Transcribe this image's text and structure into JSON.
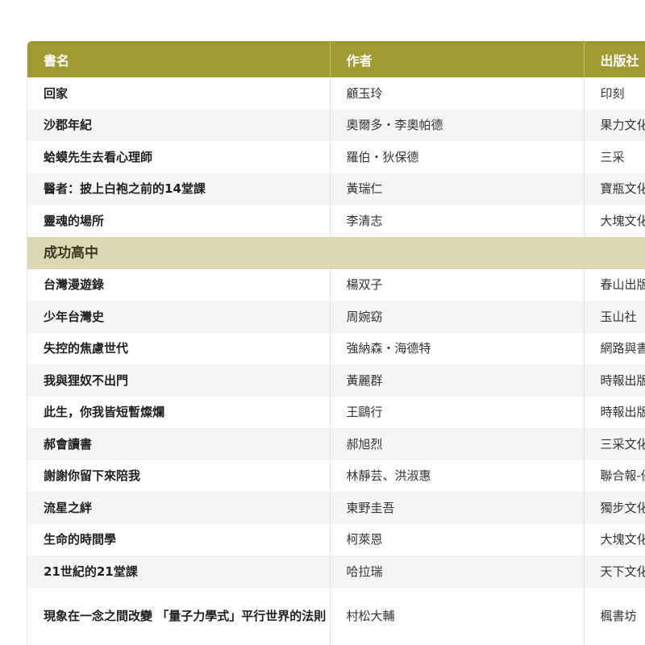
{
  "table": {
    "headers": [
      "書名",
      "作者",
      "出版社"
    ],
    "group_a": [
      {
        "title": "回家",
        "author": "顧玉玲",
        "publisher": "印刻"
      },
      {
        "title": "沙郡年紀",
        "author": "奧爾多・李奧帕德",
        "publisher": "果力文化"
      },
      {
        "title": "蛤蟆先生去看心理師",
        "author": "羅伯・狄保德",
        "publisher": "三采"
      },
      {
        "title": "醫者：披上白袍之前的14堂課",
        "author": "黃瑞仁",
        "publisher": "寶瓶文化"
      },
      {
        "title": "靈魂的場所",
        "author": "李清志",
        "publisher": "大塊文化"
      }
    ],
    "section_label": "成功高中",
    "group_b": [
      {
        "title": "台灣漫遊錄",
        "author": "楊双子",
        "publisher": "春山出版"
      },
      {
        "title": "少年台灣史",
        "author": "周婉窈",
        "publisher": "玉山社"
      },
      {
        "title": "失控的焦慮世代",
        "author": "強納森・海德特",
        "publisher": "網路與書"
      },
      {
        "title": "我與狸奴不出門",
        "author": "黃麗群",
        "publisher": "時報出版"
      },
      {
        "title": "此生，你我皆短暫燦爛",
        "author": "王鷗行",
        "publisher": "時報出版"
      },
      {
        "title": "郝會讀書",
        "author": "郝旭烈",
        "publisher": "三采文化"
      },
      {
        "title": "謝謝你留下來陪我",
        "author": "林靜芸、洪淑惠",
        "publisher": "聯合報-優"
      },
      {
        "title": "流星之絆",
        "author": "東野圭吾",
        "publisher": "獨步文化"
      },
      {
        "title": "生命的時間學",
        "author": "柯萊恩",
        "publisher": "大塊文化"
      },
      {
        "title": "21世紀的21堂課",
        "author": "哈拉瑞",
        "publisher": "天下文化"
      },
      {
        "title": "現象在一念之間改變 「量子力學式」平行世界的法則",
        "author": "村松大輔",
        "publisher": "楓書坊"
      }
    ]
  }
}
